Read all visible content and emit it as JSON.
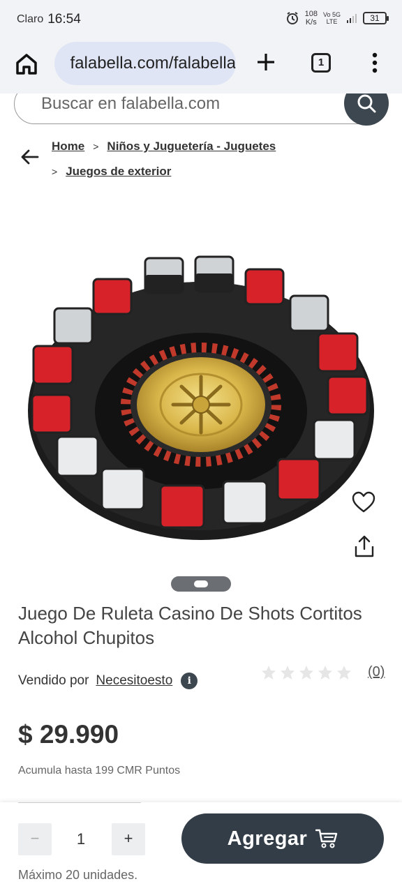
{
  "status_bar": {
    "carrier": "Claro",
    "time": "16:54",
    "speed_value": "108",
    "speed_unit": "K/s",
    "network_top": "Vo  5G",
    "network_bottom": "LTE",
    "battery": "31"
  },
  "browser": {
    "url": "falabella.com/falabella",
    "tab_count": "1"
  },
  "search": {
    "placeholder": "Buscar en falabella.com"
  },
  "breadcrumb": {
    "items": [
      "Home",
      "Niños y Juguetería - Juguetes",
      "Juegos de exterior"
    ],
    "separator": ">"
  },
  "product": {
    "title": "Juego De Ruleta Casino De Shots Cortitos Alcohol Chupitos",
    "seller_prefix": "Vendido por",
    "seller_name": "Necesitoesto",
    "rating_stars": 0,
    "rating_count": "(0)",
    "price": "$ 29.990",
    "points": "Acumula hasta 199 CMR Puntos"
  },
  "purchase": {
    "minus": "−",
    "quantity": "1",
    "plus": "+",
    "max_note": "Máximo 20 unidades.",
    "add_label": "Agregar"
  },
  "icons": {
    "home": "home-icon",
    "site_settings": "tune-icon",
    "new_tab": "plus-icon",
    "menu": "more-vertical-icon",
    "search": "search-icon",
    "back": "arrow-left-icon",
    "favorite": "heart-icon",
    "share": "share-icon",
    "cart": "cart-icon",
    "info": "info-icon"
  },
  "colors": {
    "dark_button": "#333d47",
    "browser_bg": "#f2f3f7",
    "url_pill": "#dfe5f4"
  }
}
